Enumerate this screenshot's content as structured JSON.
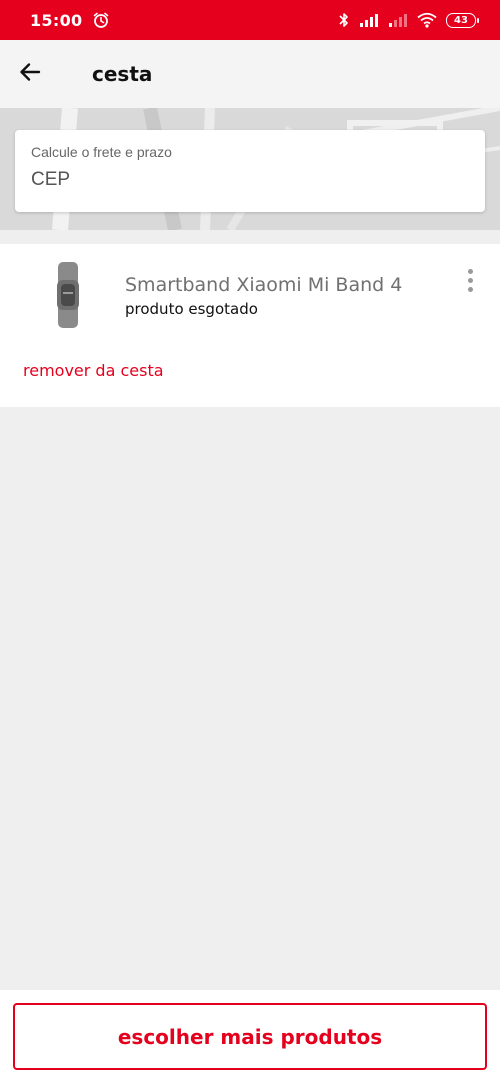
{
  "status_bar": {
    "time": "15:00",
    "battery": "43",
    "icons": [
      "alarm-icon",
      "bluetooth-icon",
      "signal-icon",
      "signal-weak-icon",
      "wifi-icon",
      "battery-icon"
    ]
  },
  "header": {
    "title": "cesta",
    "back_icon": "arrow-left-icon"
  },
  "shipping": {
    "label": "Calcule o frete e prazo",
    "placeholder": "CEP",
    "value": ""
  },
  "cart": {
    "items": [
      {
        "name": "Smartband Xiaomi Mi Band 4",
        "status": "produto esgotado",
        "image_icon": "smartband-image",
        "remove_label": "remover da cesta"
      }
    ]
  },
  "footer": {
    "button_label": "escolher mais produtos"
  },
  "colors": {
    "brand": "#e5001e",
    "background": "#efefef",
    "text_muted": "#707070"
  }
}
